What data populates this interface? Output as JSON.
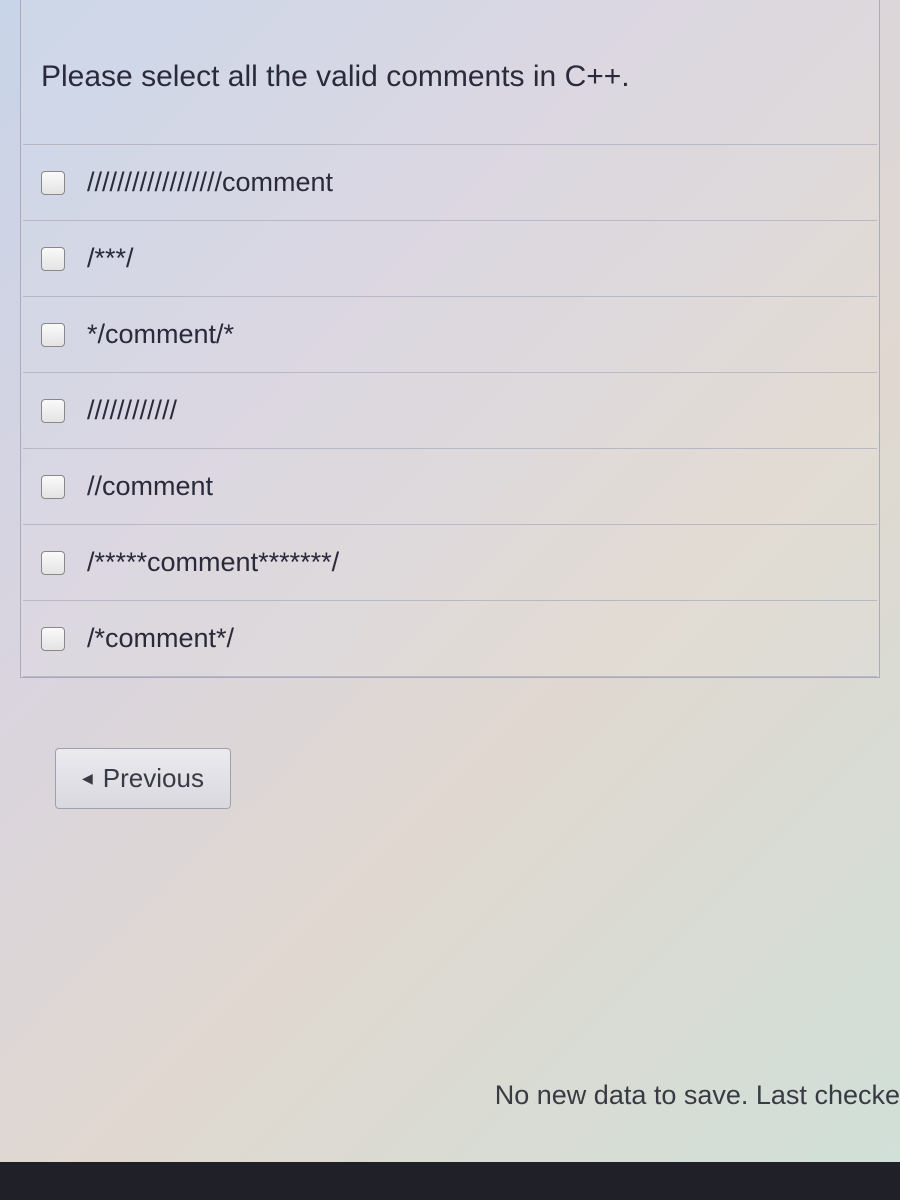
{
  "question": {
    "prompt": "Please select all the valid comments in C++.",
    "options": [
      {
        "label": "//////////////////comment"
      },
      {
        "label": "/***/"
      },
      {
        "label": "*/comment/*"
      },
      {
        "label": "////////////"
      },
      {
        "label": "//comment"
      },
      {
        "label": "/*****comment*******/"
      },
      {
        "label": "/*comment*/"
      }
    ]
  },
  "nav": {
    "previous_label": "Previous"
  },
  "status": {
    "text": "No new data to save. Last checke"
  }
}
